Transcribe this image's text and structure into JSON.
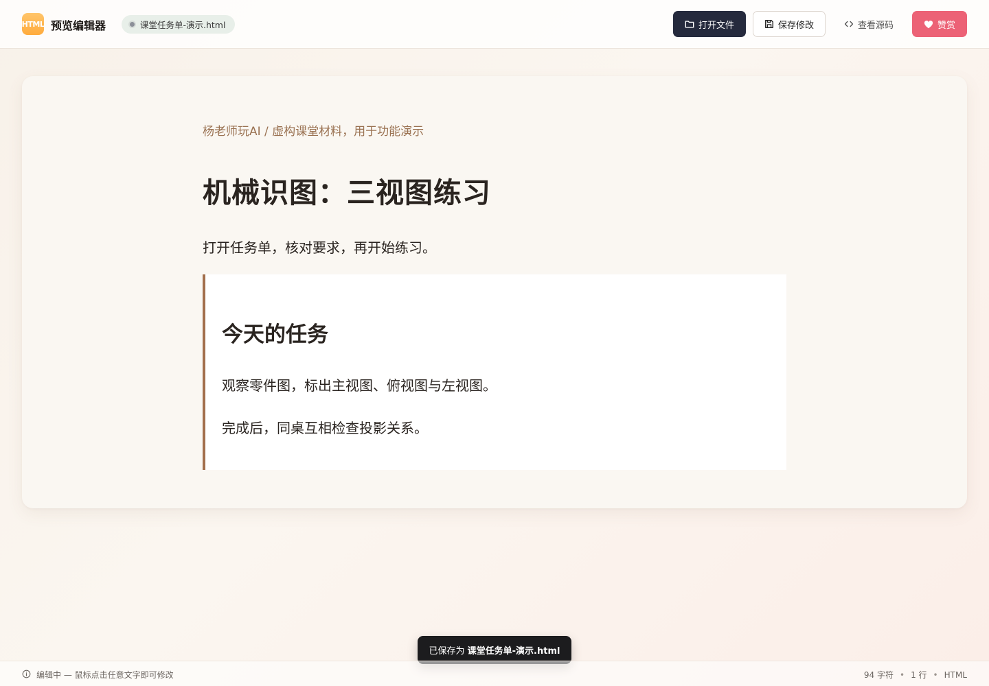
{
  "header": {
    "logo_text": "HTML",
    "app_title": "预览编辑器",
    "file_name": "课堂任务单-演示.html",
    "buttons": {
      "open": "打开文件",
      "save": "保存修改",
      "source": "查看源码",
      "like": "赞赏"
    }
  },
  "document": {
    "meta": "杨老师玩AI / 虚构课堂材料，用于功能演示",
    "title": "机械识图：三视图练习",
    "lead": "打开任务单，核对要求，再开始练习。",
    "task_box": {
      "heading": "今天的任务",
      "line1": "观察零件图，标出主视图、俯视图与左视图。",
      "line2": "完成后，同桌互相检查投影关系。"
    }
  },
  "toast": {
    "prefix": "已保存为 ",
    "file": "课堂任务单-演示.html"
  },
  "status": {
    "mode": "编辑中 — 鼠标点击任意文字即可修改",
    "chars": "94 字符",
    "lines": "1 行",
    "format": "HTML",
    "separator": "•"
  },
  "colors": {
    "primary_dark": "#252a3d",
    "like_pink": "#ec6276",
    "accent_brown": "#a26f4c",
    "logo_orange": "#ffab3d"
  },
  "icons": {
    "open": "folder-icon",
    "save": "floppy-icon",
    "source": "code-icon",
    "like": "heart-icon",
    "status": "info-icon"
  }
}
